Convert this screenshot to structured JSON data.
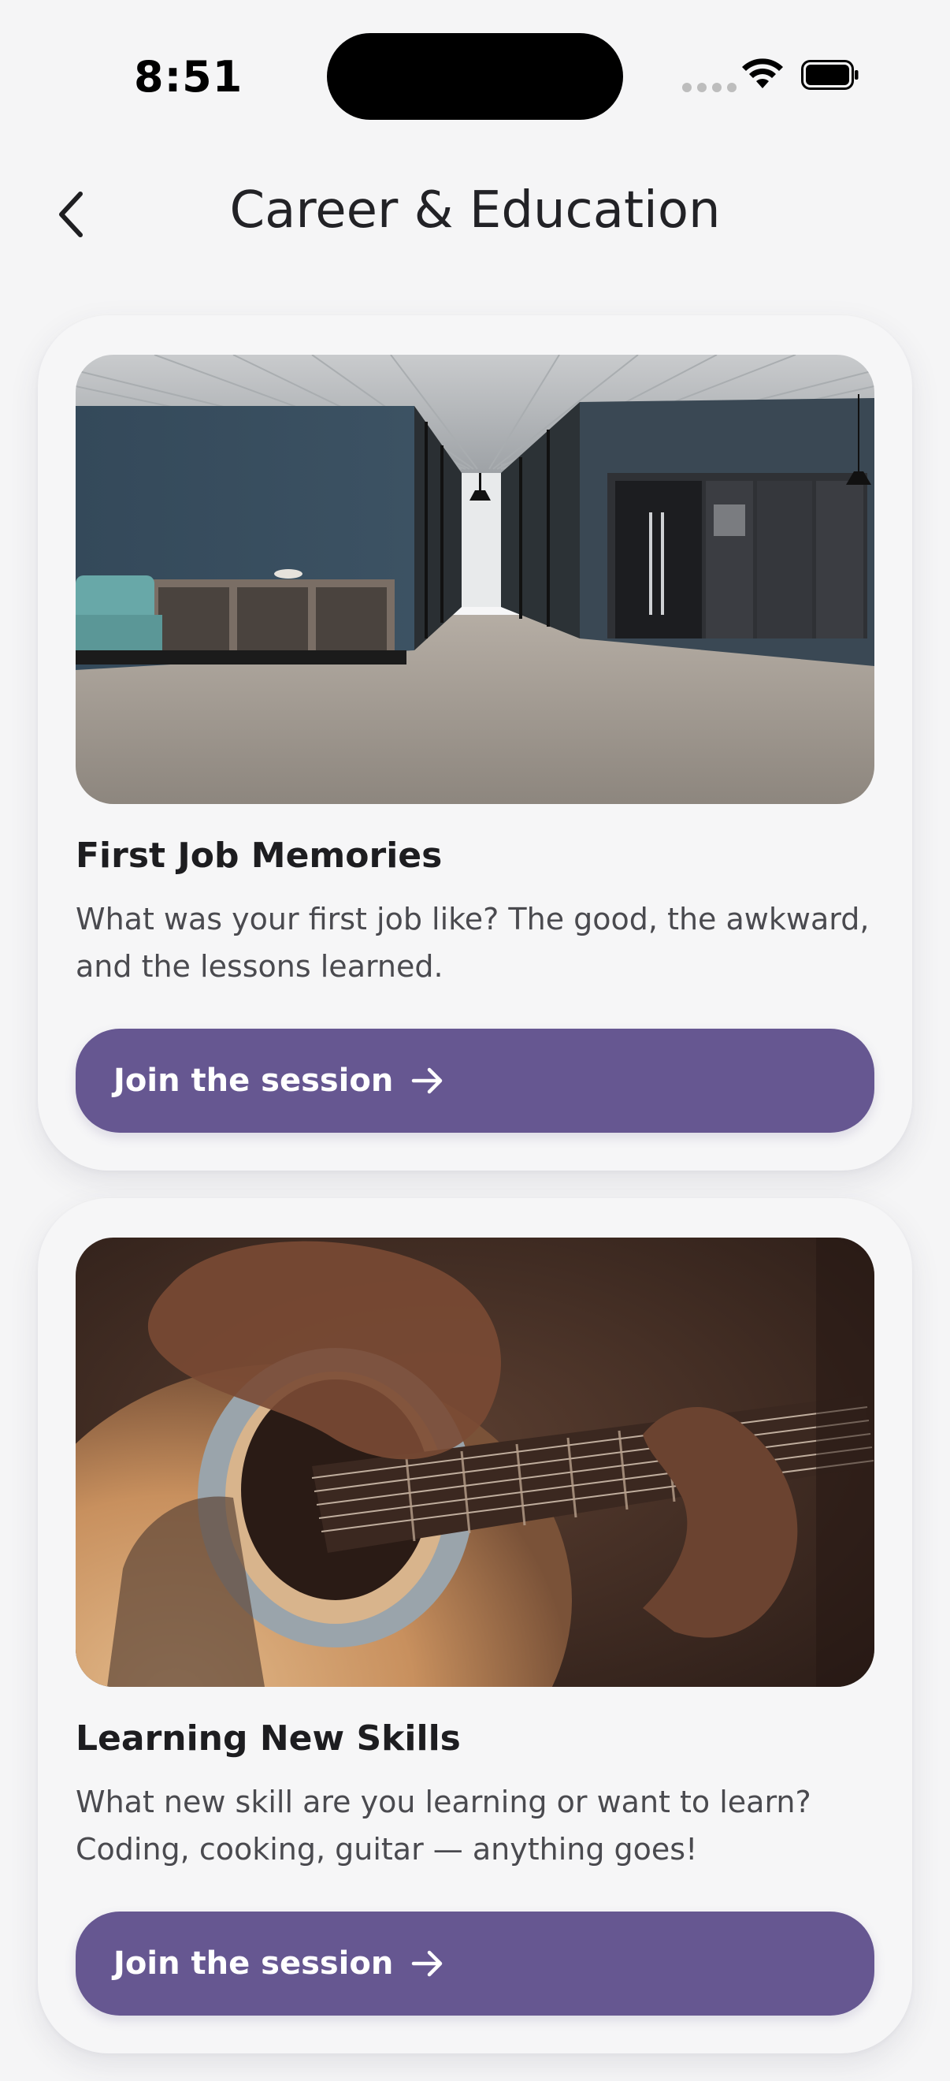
{
  "status_bar": {
    "time": "8:51",
    "wifi_icon": "wifi-icon",
    "battery_icon": "battery-icon"
  },
  "header": {
    "title": "Career & Education",
    "back_icon": "chevron-left-icon"
  },
  "cards": [
    {
      "title": "First Job Memories",
      "description": "What was your first job like? The good, the awkward, and the lessons learned.",
      "button_label": "Join the session",
      "image_subject": "office-hallway-photo"
    },
    {
      "title": "Learning New Skills",
      "description": "What new skill are you learning or want to learn? Coding, cooking, guitar — anything goes!",
      "button_label": "Join the session",
      "image_subject": "guitar-playing-photo"
    }
  ],
  "colors": {
    "background": "#f5f5f6",
    "button": "#665791",
    "button_text": "#ffffff",
    "title_text": "#1d1d20",
    "body_text": "#4a4a4f"
  }
}
